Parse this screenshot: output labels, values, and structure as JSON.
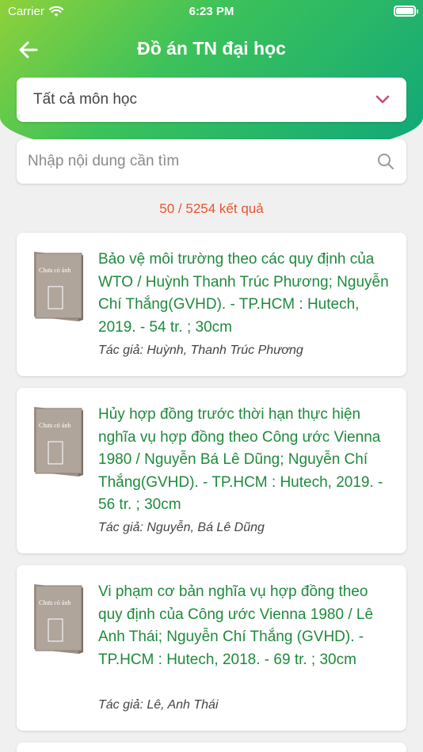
{
  "status": {
    "carrier": "Carrier",
    "time": "6:23 PM"
  },
  "header": {
    "title": "Đồ án TN đại học"
  },
  "filter": {
    "selected": "Tất cả môn học"
  },
  "search": {
    "placeholder": "Nhập nội dung cần tìm",
    "value": ""
  },
  "results": {
    "summary": "50 / 5254 kết quả"
  },
  "thumb_text": "Chưa có ảnh",
  "colors": {
    "accent_green": "#1f8a3c",
    "count_red": "#e8552e",
    "chevron": "#d14a6e"
  },
  "items": [
    {
      "title": "Bảo vệ môi trường theo các quy định của WTO  / Huỳnh Thanh Trúc Phương; Nguyễn Chí Thắng(GVHD). - TP.HCM : Hutech, 2019. - 54 tr. ; 30cm",
      "author": "Tác giả: Huỳnh, Thanh Trúc Phương"
    },
    {
      "title": "Hủy hợp đồng trước thời hạn thực hiện nghĩa vụ hợp đồng theo Công ước Vienna 1980  / Nguyễn Bá Lê Dũng; Nguyễn Chí Thắng(GVHD). - TP.HCM : Hutech, 2019. - 56 tr. ; 30cm",
      "author": "Tác giả: Nguyễn, Bá Lê Dũng"
    },
    {
      "title": "Vi phạm cơ bản nghĩa vụ hợp đồng theo quy định của Công ước Vienna 1980  / Lê Anh Thái; Nguyễn Chí Thắng (GVHD). - TP.HCM : Hutech, 2018. - 69 tr. ; 30cm",
      "author": "Tác giả: Lê, Anh Thái"
    }
  ]
}
